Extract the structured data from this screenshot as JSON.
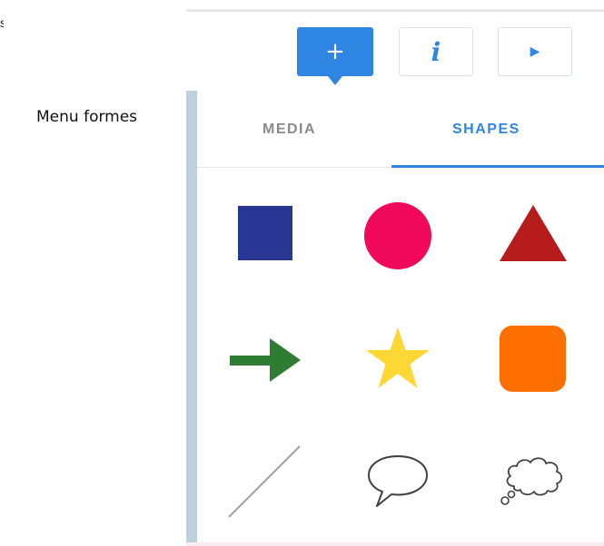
{
  "caption": "Menu formes",
  "edge_fragment": "s",
  "toolbar": {
    "add_label": "+",
    "info_label": "i",
    "play_label": "▶"
  },
  "tabs": [
    {
      "label": "MEDIA",
      "active": false
    },
    {
      "label": "SHAPES",
      "active": true
    }
  ],
  "colors": {
    "accent": "#2f86e2",
    "square": "#283593",
    "circle": "#f0085a",
    "triangle": "#b71c1c",
    "arrow": "#2e7d32",
    "star": "#fdd835",
    "rounded_square": "#ff6f00",
    "outline": "#424242"
  },
  "shapes": [
    {
      "name": "square",
      "icon": "square-icon"
    },
    {
      "name": "circle",
      "icon": "circle-icon"
    },
    {
      "name": "triangle",
      "icon": "triangle-icon"
    },
    {
      "name": "arrow",
      "icon": "arrow-right-icon"
    },
    {
      "name": "star",
      "icon": "star-icon"
    },
    {
      "name": "rounded-square",
      "icon": "rounded-square-icon"
    },
    {
      "name": "line",
      "icon": "line-icon"
    },
    {
      "name": "speech-bubble",
      "icon": "speech-bubble-icon"
    },
    {
      "name": "thought-bubble",
      "icon": "thought-bubble-icon"
    }
  ]
}
